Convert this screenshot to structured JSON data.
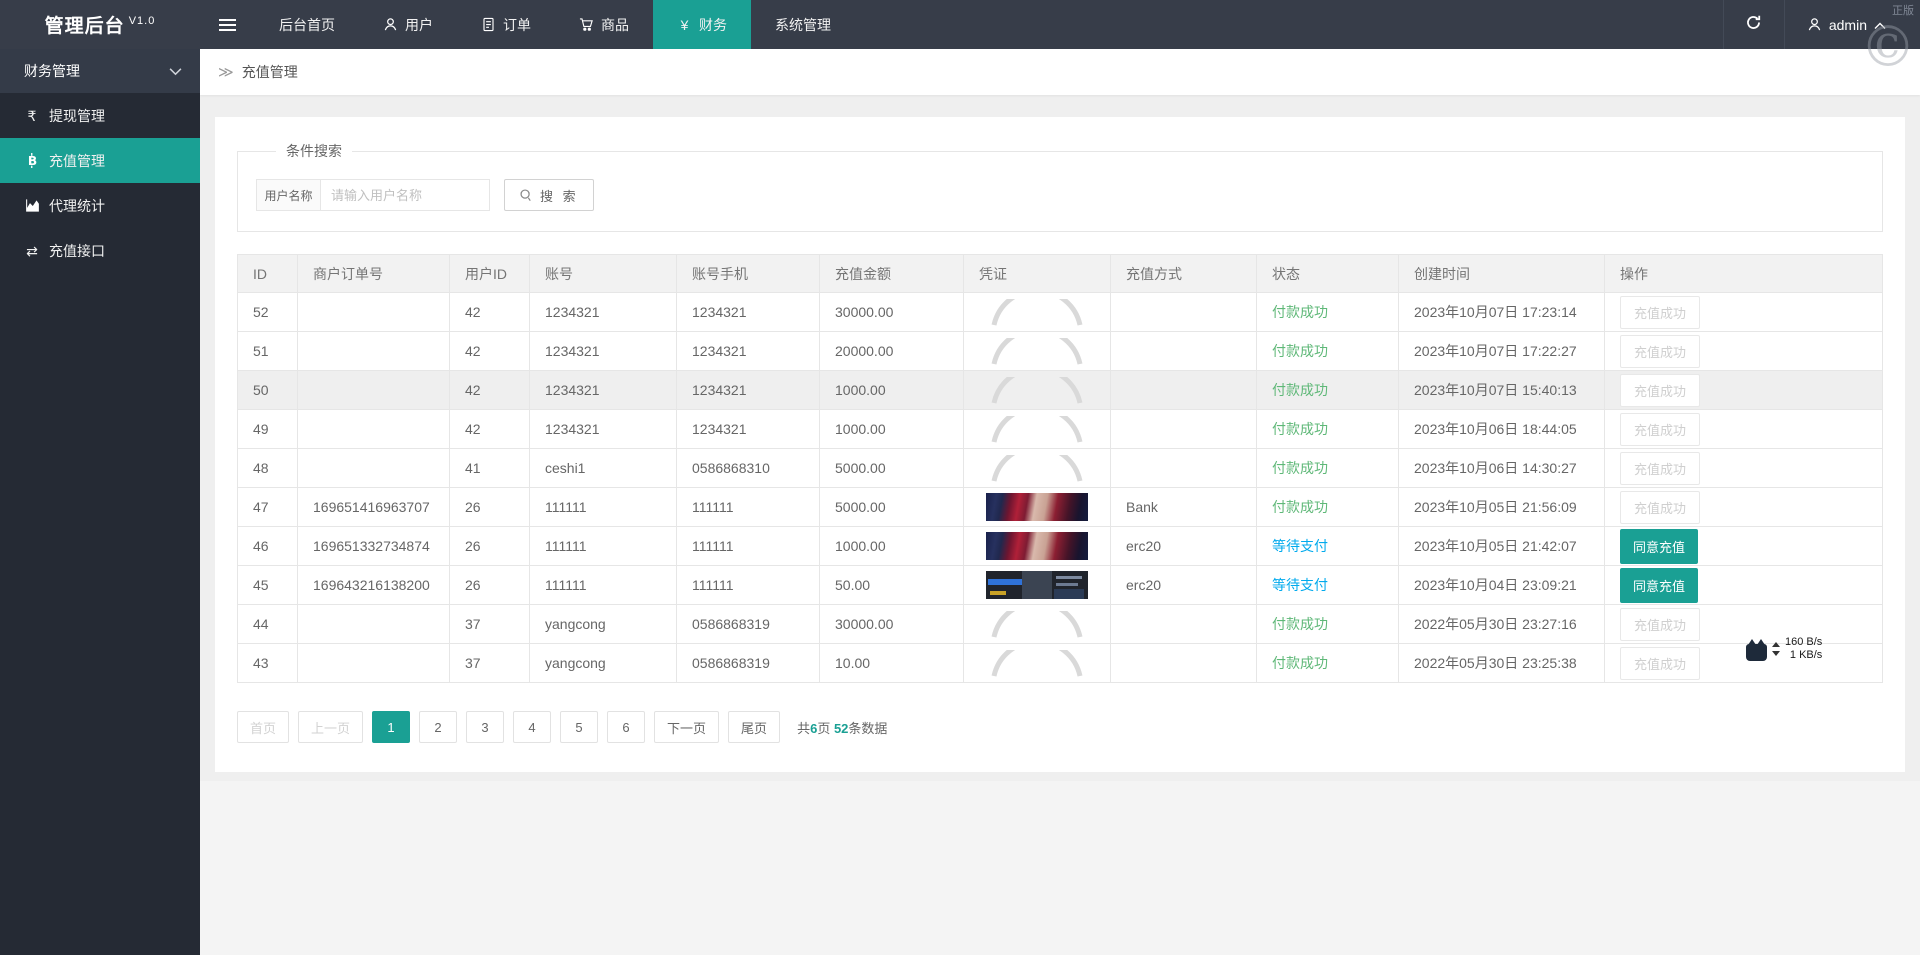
{
  "app": {
    "brand": "管理后台",
    "version": "V1.0"
  },
  "navbar": {
    "items": [
      {
        "key": "home",
        "label": "后台首页",
        "icon": "",
        "active": false
      },
      {
        "key": "users",
        "label": "用户",
        "icon": "user",
        "active": false
      },
      {
        "key": "orders",
        "label": "订单",
        "icon": "doc",
        "active": false
      },
      {
        "key": "goods",
        "label": "商品",
        "icon": "cart",
        "active": false
      },
      {
        "key": "finance",
        "label": "财务",
        "icon": "yen",
        "active": true
      },
      {
        "key": "system",
        "label": "系统管理",
        "icon": "",
        "active": false
      }
    ],
    "username": "admin"
  },
  "watermark": {
    "text": "正版",
    "symbol": "©"
  },
  "sidebar": {
    "header": "财务管理",
    "items": [
      {
        "key": "withdraw-management",
        "label": "提现管理",
        "icon": "rupee",
        "active": false
      },
      {
        "key": "recharge-management",
        "label": "充值管理",
        "icon": "bitcoin",
        "active": true
      },
      {
        "key": "agent-statistics",
        "label": "代理统计",
        "icon": "chart",
        "active": false
      },
      {
        "key": "recharge-api",
        "label": "充值接口",
        "icon": "exchange",
        "active": false
      }
    ]
  },
  "breadcrumb": {
    "separator": "≫",
    "title": "充值管理"
  },
  "search": {
    "legend": "条件搜索",
    "label": "用户名称",
    "placeholder": "请输入用户名称",
    "button": "搜 索"
  },
  "table": {
    "columns": [
      "ID",
      "商户订单号",
      "用户ID",
      "账号",
      "账号手机",
      "充值金额",
      "凭证",
      "充值方式",
      "状态",
      "创建时间",
      "操作"
    ],
    "rows": [
      {
        "id": "52",
        "order_no": "",
        "user_id": "42",
        "account": "1234321",
        "phone": "1234321",
        "amount": "30000.00",
        "voucher": "broken",
        "method": "",
        "status": "付款成功",
        "status_type": "success",
        "created": "2023年10月07日 17:23:14",
        "action": "充值成功",
        "action_type": "done",
        "highlight": false
      },
      {
        "id": "51",
        "order_no": "",
        "user_id": "42",
        "account": "1234321",
        "phone": "1234321",
        "amount": "20000.00",
        "voucher": "broken",
        "method": "",
        "status": "付款成功",
        "status_type": "success",
        "created": "2023年10月07日 17:22:27",
        "action": "充值成功",
        "action_type": "done",
        "highlight": false
      },
      {
        "id": "50",
        "order_no": "",
        "user_id": "42",
        "account": "1234321",
        "phone": "1234321",
        "amount": "1000.00",
        "voucher": "broken",
        "method": "",
        "status": "付款成功",
        "status_type": "success",
        "created": "2023年10月07日 15:40:13",
        "action": "充值成功",
        "action_type": "done",
        "highlight": true
      },
      {
        "id": "49",
        "order_no": "",
        "user_id": "42",
        "account": "1234321",
        "phone": "1234321",
        "amount": "1000.00",
        "voucher": "broken",
        "method": "",
        "status": "付款成功",
        "status_type": "success",
        "created": "2023年10月06日 18:44:05",
        "action": "充值成功",
        "action_type": "done",
        "highlight": false
      },
      {
        "id": "48",
        "order_no": "",
        "user_id": "41",
        "account": "ceshi1",
        "phone": "0586868310",
        "amount": "5000.00",
        "voucher": "broken",
        "method": "",
        "status": "付款成功",
        "status_type": "success",
        "created": "2023年10月06日 14:30:27",
        "action": "充值成功",
        "action_type": "done",
        "highlight": false
      },
      {
        "id": "47",
        "order_no": "169651416963707",
        "user_id": "26",
        "account": "111111",
        "phone": "111111",
        "amount": "5000.00",
        "voucher": "face",
        "method": "Bank",
        "status": "付款成功",
        "status_type": "success",
        "created": "2023年10月05日 21:56:09",
        "action": "充值成功",
        "action_type": "done",
        "highlight": false
      },
      {
        "id": "46",
        "order_no": "169651332734874",
        "user_id": "26",
        "account": "111111",
        "phone": "111111",
        "amount": "1000.00",
        "voucher": "face",
        "method": "erc20",
        "status": "等待支付",
        "status_type": "pending",
        "created": "2023年10月05日 21:42:07",
        "action": "同意充值",
        "action_type": "approve",
        "highlight": false
      },
      {
        "id": "45",
        "order_no": "169643216138200",
        "user_id": "26",
        "account": "111111",
        "phone": "111111",
        "amount": "50.00",
        "voucher": "screen",
        "method": "erc20",
        "status": "等待支付",
        "status_type": "pending",
        "created": "2023年10月04日 23:09:21",
        "action": "同意充值",
        "action_type": "approve",
        "highlight": false
      },
      {
        "id": "44",
        "order_no": "",
        "user_id": "37",
        "account": "yangcong",
        "phone": "0586868319",
        "amount": "30000.00",
        "voucher": "broken",
        "method": "",
        "status": "付款成功",
        "status_type": "success",
        "created": "2022年05月30日 23:27:16",
        "action": "充值成功",
        "action_type": "done",
        "highlight": false
      },
      {
        "id": "43",
        "order_no": "",
        "user_id": "37",
        "account": "yangcong",
        "phone": "0586868319",
        "amount": "10.00",
        "voucher": "broken",
        "method": "",
        "status": "付款成功",
        "status_type": "success",
        "created": "2022年05月30日 23:25:38",
        "action": "充值成功",
        "action_type": "done",
        "highlight": false
      }
    ]
  },
  "pagination": {
    "first": "首页",
    "prev": "上一页",
    "next": "下一页",
    "last": "尾页",
    "pages": [
      "1",
      "2",
      "3",
      "4",
      "5",
      "6"
    ],
    "active_page": "1",
    "summary": [
      {
        "text": "共",
        "accent": false
      },
      {
        "text": "6",
        "accent": true
      },
      {
        "text": "页 ",
        "accent": false
      },
      {
        "text": "52",
        "accent": true
      },
      {
        "text": "条数据",
        "accent": false
      }
    ]
  },
  "net_monitor": {
    "up_speed": "160 B/s",
    "down_speed": "1 KB/s"
  }
}
